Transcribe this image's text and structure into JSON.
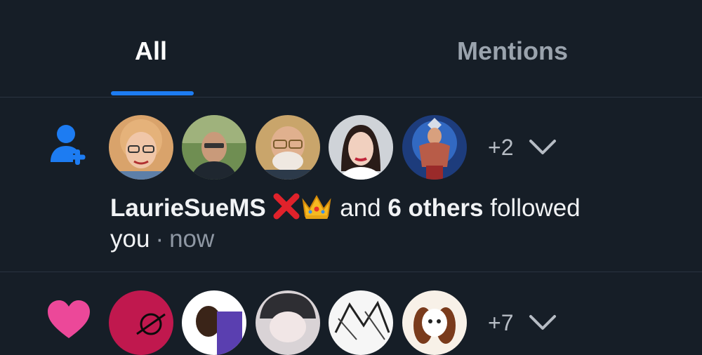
{
  "tabs": [
    {
      "label": "All",
      "active": true
    },
    {
      "label": "Mentions",
      "active": false
    }
  ],
  "colors": {
    "background": "#161e27",
    "accent": "#1d7cf2",
    "follow_icon": "#1d7cf2",
    "like_icon": "#ec4899"
  },
  "notifications": [
    {
      "type_icon": "person-plus-icon",
      "avatars": [
        "avatar-1",
        "avatar-2",
        "avatar-3",
        "avatar-4",
        "avatar-5"
      ],
      "more_count": "+2",
      "actor": "LaurieSueMS",
      "actor_emojis": [
        "cross-mark-emoji",
        "crown-emoji"
      ],
      "and_text": "and",
      "others_text": "6 others",
      "action_text": "followed you",
      "separator": "·",
      "time": "now"
    },
    {
      "type_icon": "heart-icon",
      "avatars": [
        "avatar-1",
        "avatar-2",
        "avatar-3",
        "avatar-4",
        "avatar-5"
      ],
      "more_count": "+7"
    }
  ]
}
